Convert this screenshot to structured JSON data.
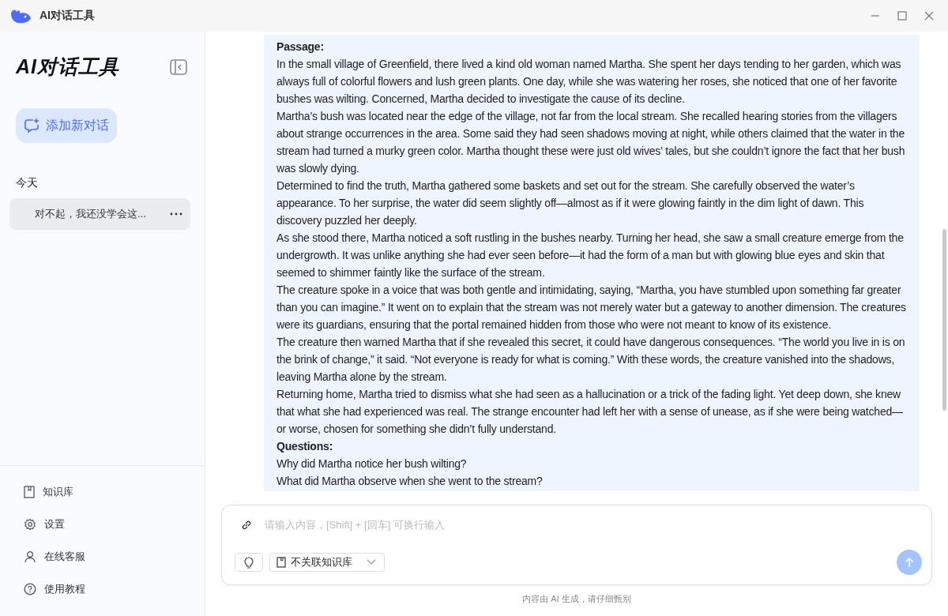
{
  "window": {
    "title": "AI对话工具"
  },
  "sidebar": {
    "title": "AI对话工具",
    "new_chat": "添加新对话",
    "group_label": "今天",
    "conversations": [
      {
        "title": "对不起，我还没学会这...",
        "selected": true
      }
    ],
    "footer_items": [
      {
        "kind": "book",
        "label": "知识库"
      },
      {
        "kind": "gear",
        "label": "设置"
      },
      {
        "kind": "person",
        "label": "在线客服"
      },
      {
        "kind": "help",
        "label": "使用教程"
      }
    ]
  },
  "message": {
    "blocks": [
      {
        "kind": "heading",
        "text": "Passage:"
      },
      {
        "kind": "para",
        "text": "In the small village of Greenfield, there lived a kind old woman named Martha. She spent her days tending to her garden, which was always full of colorful flowers and lush green plants. One day, while she was watering her roses, she noticed that one of her favorite bushes was wilting. Concerned, Martha decided to investigate the cause of its decline."
      },
      {
        "kind": "para",
        "text": "Martha’s bush was located near the edge of the village, not far from the local stream. She recalled hearing stories from the villagers about strange occurrences in the area. Some said they had seen shadows moving at night, while others claimed that the water in the stream had turned a murky green color. Martha thought these were just old wives’ tales, but she couldn’t ignore the fact that her bush was slowly dying."
      },
      {
        "kind": "para",
        "text": "Determined to find the truth, Martha gathered some baskets and set out for the stream. She carefully observed the water’s appearance. To her surprise, the water did seem slightly off—almost as if it were glowing faintly in the dim light of dawn. This discovery puzzled her deeply."
      },
      {
        "kind": "para",
        "text": "As she stood there, Martha noticed a soft rustling in the bushes nearby. Turning her head, she saw a small creature emerge from the undergrowth. It was unlike anything she had ever seen before—it had the form of a man but with glowing blue eyes and skin that seemed to shimmer faintly like the surface of the stream."
      },
      {
        "kind": "para",
        "text": "The creature spoke in a voice that was both gentle and intimidating, saying, “Martha, you have stumbled upon something far greater than you can imagine.” It went on to explain that the stream was not merely water but a gateway to another dimension. The creatures were its guardians, ensuring that the portal remained hidden from those who were not meant to know of its existence."
      },
      {
        "kind": "para",
        "text": "The creature then warned Martha that if she revealed this secret, it could have dangerous consequences. “The world you live in is on the brink of change,” it said. “Not everyone is ready for what is coming.” With these words, the creature vanished into the shadows, leaving Martha alone by the stream."
      },
      {
        "kind": "para",
        "text": "Returning home, Martha tried to dismiss what she had seen as a hallucination or a trick of the fading light. Yet deep down, she knew that what she had experienced was real. The strange encounter had left her with a sense of unease, as if she were being watched—or worse, chosen for something she didn’t fully understand."
      },
      {
        "kind": "heading",
        "text": "Questions:"
      },
      {
        "kind": "para",
        "text": "Why did Martha notice her bush wilting?"
      },
      {
        "kind": "para",
        "text": "What did Martha observe when she went to the stream?"
      }
    ]
  },
  "composer": {
    "placeholder": "请输入内容，[Shift] + [回车] 可换行输入",
    "knowledge_select": "不关联知识库"
  },
  "disclaimer": "内容由 AI 生成，请仔细甄别"
}
